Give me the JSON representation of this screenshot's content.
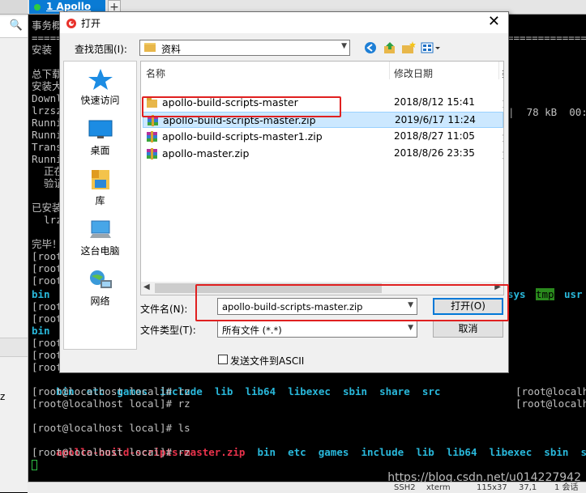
{
  "left_panel": {
    "search_glyph": "🔍",
    "side_glyph": "z"
  },
  "tabs": [
    {
      "label": "1 Apollo",
      "status_color": "#2ecc40"
    }
  ],
  "tab_add": "+",
  "terminal": {
    "lines": [
      {
        "text": "事务概"
      },
      {
        "text": "================================================================================================="
      },
      {
        "text": "安装"
      },
      {
        "text": ""
      },
      {
        "text": "总下载"
      },
      {
        "text": "安装大"
      },
      {
        "text": "Downl"
      },
      {
        "text": "lrzsz"
      },
      {
        "text": "Runni"
      },
      {
        "text": "Runni"
      },
      {
        "text": "Trans"
      },
      {
        "text": "Runni"
      },
      {
        "text": "  正在"
      },
      {
        "text": "  验证"
      },
      {
        "text": ""
      },
      {
        "text": "已安装"
      },
      {
        "text": "  lrz"
      },
      {
        "text": ""
      },
      {
        "text": "完毕！"
      },
      {
        "text": "[root"
      },
      {
        "text": "[root"
      },
      {
        "text": "[root"
      }
    ],
    "right_fragments": {
      "progress": "|  78 kB  00:0",
      "sys": "sys",
      "tmp": "tmp",
      "usr": "usr",
      "prompt1": "[root@localho",
      "prompt2": "[root@localho"
    },
    "lower_lines": [
      {
        "text": "bin",
        "style": "cyan"
      },
      {
        "text": "[root"
      },
      {
        "text": "[root"
      },
      {
        "text": "bin",
        "style": "cyan"
      },
      {
        "text": "[root"
      },
      {
        "text": "[root"
      },
      {
        "text": "[root"
      }
    ],
    "ls_dirs": [
      "bin",
      "etc",
      "games",
      "include",
      "lib",
      "lib64",
      "libexec",
      "sbin",
      "share",
      "src"
    ],
    "rz_line_1": "[root@localhost local]# rz",
    "rz_line_2": "[root@localhost local]# rz",
    "ls_cmd": "[root@localhost local]# ls",
    "zip_file": "apollo-build-scripts-master.zip",
    "rz_line_3": "[root@localhost local]# rz"
  },
  "statusbar": {
    "ssh": "SSH2",
    "term": "xterm",
    "size": "115x37",
    "pos": "37,1",
    "sessions": "1 会话"
  },
  "watermark": "https://blog.csdn.net/u014227942",
  "dialog": {
    "title": "打开",
    "close_glyph": "✕",
    "lookin_label": "查找范围(I):",
    "lookin_value": "资料",
    "places": [
      {
        "label": "快速访问",
        "icon": "star-icon"
      },
      {
        "label": "桌面",
        "icon": "desktop-icon"
      },
      {
        "label": "库",
        "icon": "library-icon"
      },
      {
        "label": "这台电脑",
        "icon": "computer-icon"
      },
      {
        "label": "网络",
        "icon": "network-icon"
      }
    ],
    "columns": {
      "name": "名称",
      "date": "修改日期",
      "type": "类"
    },
    "files": [
      {
        "name": "apollo-build-scripts-master",
        "date": "2018/8/12 15:41",
        "type": "文",
        "kind": "folder"
      },
      {
        "name": "apollo-build-scripts-master.zip",
        "date": "2019/6/17 11:24",
        "type": "好",
        "kind": "zip",
        "selected": true
      },
      {
        "name": "apollo-build-scripts-master1.zip",
        "date": "2018/8/27 11:05",
        "type": "好",
        "kind": "zip"
      },
      {
        "name": "apollo-master.zip",
        "date": "2018/8/26 23:35",
        "type": "好",
        "kind": "zip"
      }
    ],
    "filename_label": "文件名(N):",
    "filename_value": "apollo-build-scripts-master.zip",
    "filetype_label": "文件类型(T):",
    "filetype_value": "所有文件 (*.*)",
    "open_button": "打开(O)",
    "cancel_button": "取消",
    "ascii_label": "发送文件到ASCII",
    "highlight_color": "#e02020"
  }
}
